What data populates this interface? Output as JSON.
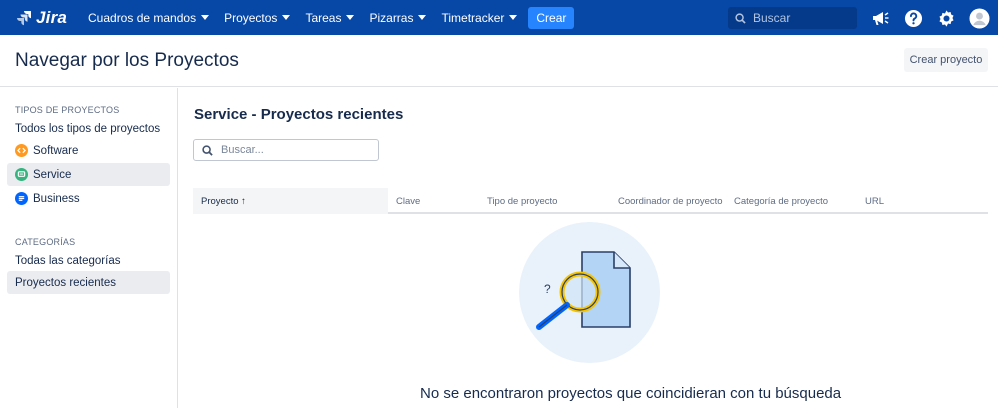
{
  "topnav": {
    "logo": "Jira",
    "items": [
      {
        "label": "Cuadros de mandos"
      },
      {
        "label": "Proyectos"
      },
      {
        "label": "Tareas"
      },
      {
        "label": "Pizarras"
      },
      {
        "label": "Timetracker"
      }
    ],
    "create_label": "Crear",
    "search_placeholder": "Buscar",
    "icons": [
      "announcement-icon",
      "help-icon",
      "settings-icon",
      "avatar"
    ]
  },
  "header": {
    "title": "Navegar por los Proyectos",
    "create_project_label": "Crear proyecto"
  },
  "sidebar": {
    "types_title": "TIPOS DE PROYECTOS",
    "types": [
      {
        "label": "Todos los tipos de proyectos",
        "icon": "",
        "color": ""
      },
      {
        "label": "Software",
        "icon": "code-icon",
        "color": "#ff991f"
      },
      {
        "label": "Service",
        "icon": "service-icon",
        "color": "#36b37e"
      },
      {
        "label": "Business",
        "icon": "business-icon",
        "color": "#0065ff"
      }
    ],
    "categories_title": "CATEGORÍAS",
    "categories": [
      {
        "label": "Todas las categorías"
      },
      {
        "label": "Proyectos recientes"
      }
    ]
  },
  "main": {
    "title": "Service - Proyectos recientes",
    "filter_placeholder": "Buscar...",
    "columns": [
      {
        "label": "Proyecto ↑"
      },
      {
        "label": "Clave"
      },
      {
        "label": "Tipo de proyecto"
      },
      {
        "label": "Coordinador de proyecto"
      },
      {
        "label": "Categoría de proyecto"
      },
      {
        "label": "URL"
      }
    ],
    "empty_message": "No se encontraron proyectos que coincidieran con tu búsqueda"
  },
  "colors": {
    "nav_bg": "#0747a6",
    "accent": "#2684ff",
    "text": "#172b4d"
  }
}
